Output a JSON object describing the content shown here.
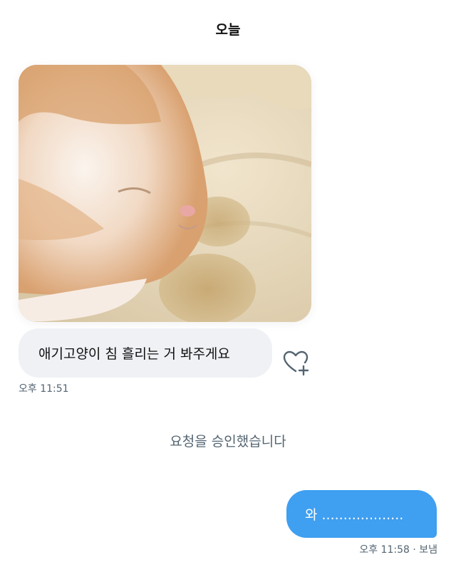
{
  "date_header": "오늘",
  "received": {
    "photo_alt": "cat-photo",
    "message_text": "애기고양이 침 흘리는 거 봐주게요",
    "time": "오후 11:51"
  },
  "system_note": "요청을 승인했습니다",
  "sent": {
    "message_text": "와 ...................",
    "time": "오후 11:58 · 보냄"
  },
  "colors": {
    "sent_bubble": "#3f9ff0",
    "received_bubble": "#eff1f4",
    "meta_text": "#536471"
  },
  "icons": {
    "like": "heart-plus-icon"
  }
}
